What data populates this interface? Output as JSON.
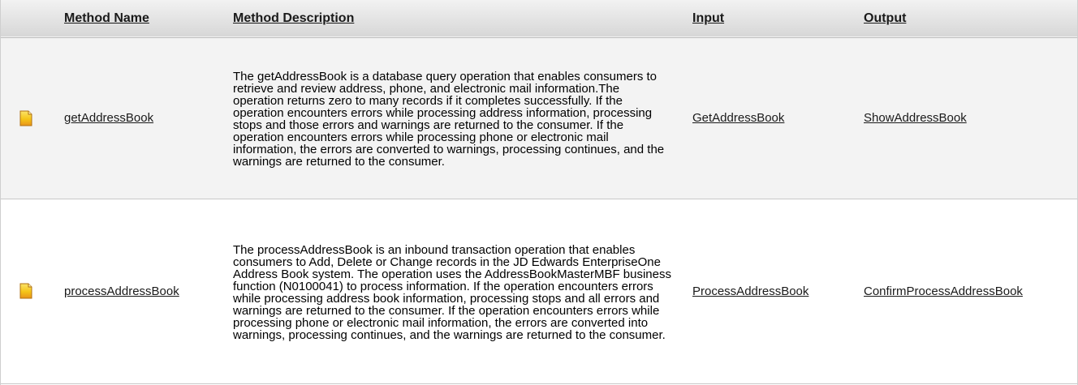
{
  "table": {
    "headers": {
      "method_name": "Method Name",
      "method_description": "Method Description",
      "input": "Input",
      "output": "Output"
    },
    "rows": [
      {
        "icon": "document-icon",
        "method_name": "getAddressBook",
        "description": "The getAddressBook is a database query operation that enables consumers to retrieve and review address, phone, and electronic mail information.The operation returns zero to many records if it completes successfully. If the operation encounters errors while processing address information, processing stops and those errors and warnings are returned to the consumer. If the operation encounters errors while processing phone or electronic mail information, the errors are converted to warnings, processing continues, and the warnings are returned to the consumer.",
        "input": "GetAddressBook",
        "output": "ShowAddressBook"
      },
      {
        "icon": "document-icon",
        "method_name": "processAddressBook",
        "description": "The processAddressBook is an inbound transaction operation that enables consumers to Add, Delete or Change records in the JD Edwards EnterpriseOne Address Book system. The operation uses the AddressBookMasterMBF business function (N0100041) to process information. If the operation encounters errors while processing address book information, processing stops and all errors and warnings are returned to the consumer. If the operation encounters errors while processing phone or electronic mail information, the errors are converted into warnings, processing continues, and the warnings are returned to the consumer.",
        "input": "ProcessAddressBook",
        "output": "ConfirmProcessAddressBook"
      }
    ]
  },
  "colors": {
    "header_gradient_top": "#f2f2f2",
    "header_gradient_bottom": "#d7d7d7",
    "row_alt": "#f3f3f3",
    "icon_yellow": "#f5c518",
    "icon_orange": "#e8941a"
  }
}
